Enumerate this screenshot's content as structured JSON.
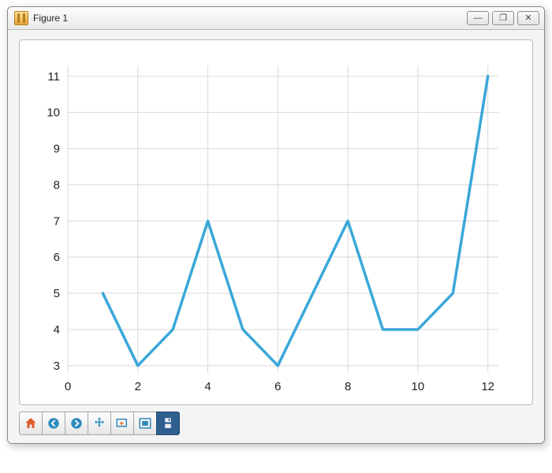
{
  "window": {
    "title": "Figure 1",
    "buttons": {
      "minimize": "—",
      "maximize": "❐",
      "close": "✕"
    }
  },
  "toolbar": {
    "items": [
      {
        "name": "home-button",
        "icon": "home-icon"
      },
      {
        "name": "back-button",
        "icon": "arrow-left-icon"
      },
      {
        "name": "forward-button",
        "icon": "arrow-right-icon"
      },
      {
        "name": "pan-button",
        "icon": "move-icon"
      },
      {
        "name": "zoom-button",
        "icon": "zoom-rect-icon"
      },
      {
        "name": "subplots-config-button",
        "icon": "subplots-icon"
      },
      {
        "name": "save-button",
        "icon": "save-icon",
        "active": true
      }
    ]
  },
  "chart_data": {
    "type": "line",
    "title": "",
    "xlabel": "",
    "ylabel": "",
    "x": [
      1,
      2,
      3,
      4,
      5,
      6,
      7,
      8,
      9,
      10,
      11,
      12
    ],
    "values": [
      5,
      3,
      4,
      7,
      4,
      3,
      5,
      7,
      4,
      4,
      5,
      11
    ],
    "xticks": [
      0,
      2,
      4,
      6,
      8,
      10,
      12
    ],
    "yticks": [
      3,
      4,
      5,
      6,
      7,
      8,
      9,
      10,
      11
    ],
    "xlim": [
      0,
      12.3
    ],
    "ylim": [
      2.8,
      11.3
    ],
    "grid": true,
    "line_color": "#3aa7d9"
  }
}
